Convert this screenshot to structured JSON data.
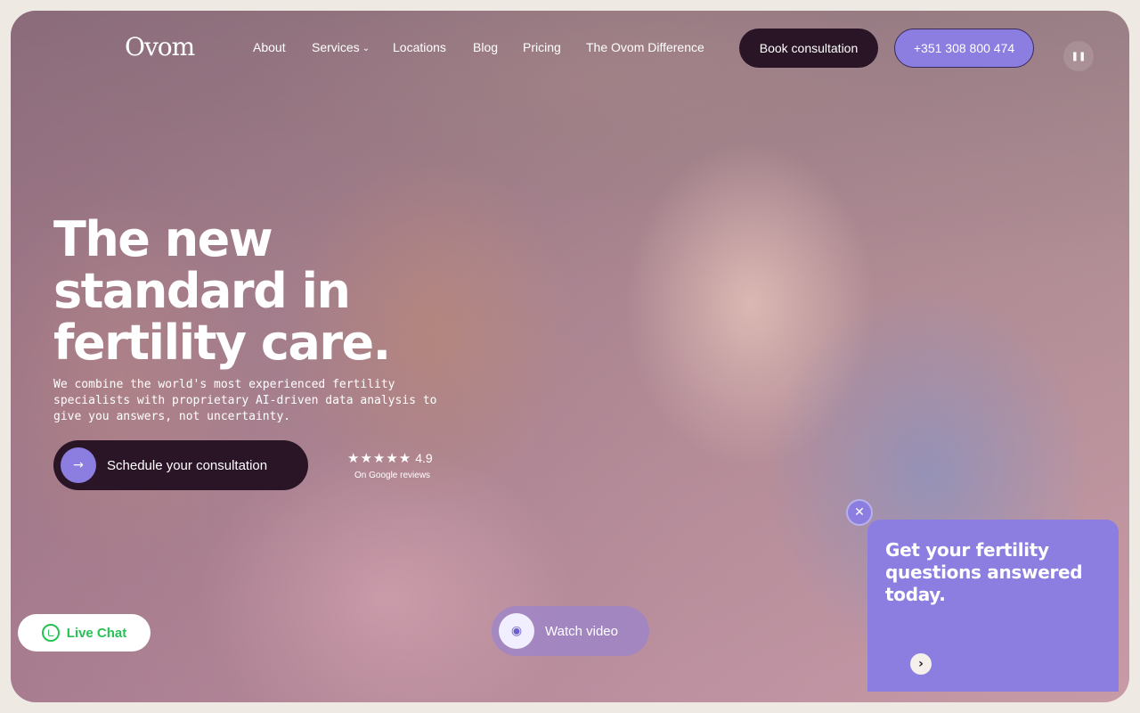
{
  "nav": {
    "logo": "Ovom",
    "links": [
      {
        "label": "About"
      },
      {
        "label": "Services"
      },
      {
        "label": "Locations"
      },
      {
        "label": "Blog"
      },
      {
        "label": "Pricing"
      },
      {
        "label": "The Ovom Difference"
      }
    ],
    "book_label": "Book consultation",
    "phone_label": "+351 308 800 474",
    "pause_icon": "pause-icon"
  },
  "hero": {
    "headline": "The new standard in fertility care.",
    "subtext": "We combine the world's most experienced fertility specialists with proprietary AI-driven data analysis to give you answers, not uncertainty.",
    "cta_label": "Schedule your consultation",
    "rating_value": "4.9",
    "rating_stars": "★★★★★",
    "rating_source": "On Google reviews"
  },
  "live_chat": {
    "label": "Live Chat",
    "icon": "whatsapp-icon"
  },
  "video": {
    "label": "Watch video",
    "icon": "eye-icon"
  },
  "popup": {
    "title": "Get your fertility questions answered today.",
    "close_icon": "close-icon",
    "arrow_icon": "chevron-right-icon"
  },
  "colors": {
    "accent": "#8b7ee0",
    "dark": "#2a1527",
    "whatsapp": "#25c254",
    "page_bg": "#efe9e4"
  }
}
